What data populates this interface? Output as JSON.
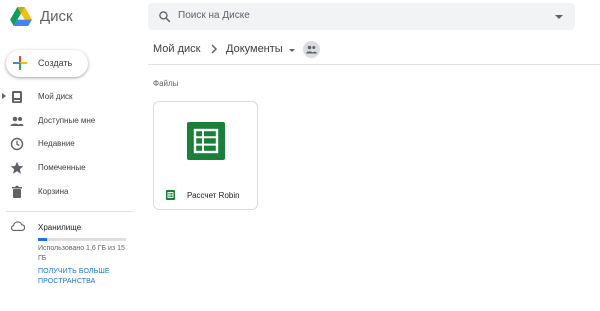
{
  "app": {
    "title": "Диск"
  },
  "search": {
    "placeholder": "Поиск на Диске"
  },
  "create_button": {
    "label": "Создать"
  },
  "sidebar": {
    "items": [
      {
        "label": "Мой диск",
        "icon": "my-drive-icon"
      },
      {
        "label": "Доступные мне",
        "icon": "people-icon"
      },
      {
        "label": "Недавние",
        "icon": "clock-icon"
      },
      {
        "label": "Помеченные",
        "icon": "star-icon"
      },
      {
        "label": "Корзина",
        "icon": "trash-icon"
      }
    ]
  },
  "storage": {
    "title": "Хранилище",
    "usage_text": "Использовано 1,6 ГБ из 15 ГБ",
    "used_fraction": 0.107,
    "upgrade_link": "Получить больше пространства"
  },
  "breadcrumb": {
    "root": "Мой диск",
    "current": "Документы"
  },
  "files_section": {
    "title": "Файлы"
  },
  "files": [
    {
      "name": "Рассчет Robin",
      "type": "spreadsheet"
    }
  ],
  "colors": {
    "sheets_green": "#188038",
    "accent_blue": "#1a73e8"
  }
}
